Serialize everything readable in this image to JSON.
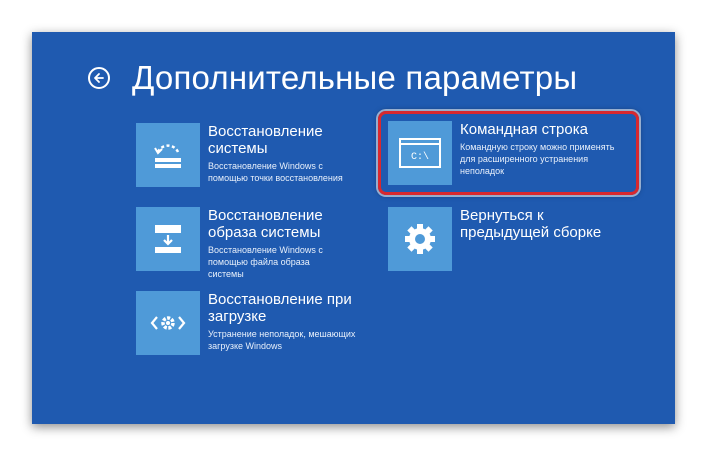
{
  "header": {
    "title": "Дополнительные параметры",
    "back_icon": "back-arrow-icon"
  },
  "tiles": [
    {
      "title": "Восстановление системы",
      "description": "Восстановление Windows с помощью точки восстановления",
      "icon": "system-restore-icon"
    },
    {
      "title": "Восстановление образа системы",
      "description": "Восстановление Windows с помощью файла образа системы",
      "icon": "system-image-recovery-icon"
    },
    {
      "title": "Восстановление при загрузке",
      "description": "Устранение неполадок, мешающих загрузке Windows",
      "icon": "startup-repair-icon"
    },
    {
      "title": "Командная строка",
      "description": "Командную строку можно применять для расширенного устранения неполадок",
      "icon": "command-prompt-icon",
      "icon_text": "C:\\"
    },
    {
      "title": "Вернуться к предыдущей сборке",
      "description": "",
      "icon": "gear-icon"
    }
  ],
  "colors": {
    "background": "#1f5ab0",
    "tile": "#4f9ad8",
    "highlight": "#d8282e"
  }
}
